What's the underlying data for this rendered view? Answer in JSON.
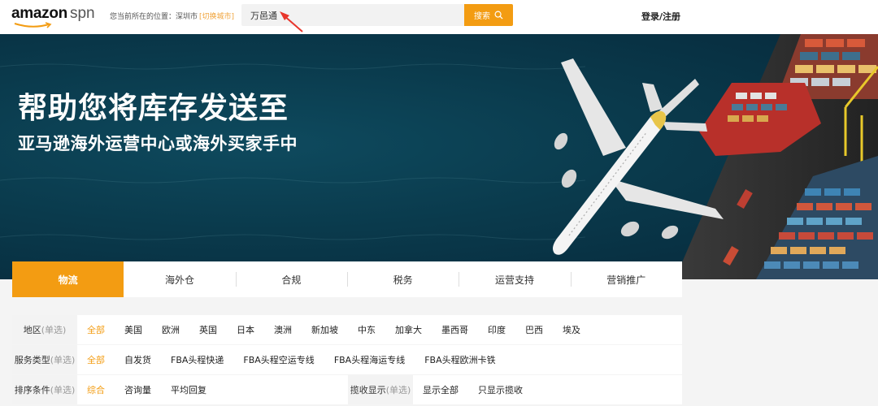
{
  "header": {
    "logo_main": "amazon",
    "logo_sub": "spn",
    "location_prefix": "您当前所在的位置：深圳市",
    "city_switch": "[切换城市]",
    "search_value": "万邑通",
    "search_button": "搜索",
    "login": "登录/注册"
  },
  "hero": {
    "title": "帮助您将库存发送至",
    "subtitle": "亚马逊海外运营中心或海外买家手中"
  },
  "tabs": [
    {
      "label": "物流",
      "active": true
    },
    {
      "label": "海外仓"
    },
    {
      "label": "合规"
    },
    {
      "label": "税务"
    },
    {
      "label": "运营支持"
    },
    {
      "label": "营销推广"
    }
  ],
  "filters": {
    "region": {
      "label": "地区",
      "mode": "(单选)",
      "options": [
        "全部",
        "美国",
        "欧洲",
        "英国",
        "日本",
        "澳洲",
        "新加坡",
        "中东",
        "加拿大",
        "墨西哥",
        "印度",
        "巴西",
        "埃及"
      ]
    },
    "service": {
      "label": "服务类型",
      "mode": "(单选)",
      "options": [
        "全部",
        "自发货",
        "FBA头程快递",
        "FBA头程空运专线",
        "FBA头程海运专线",
        "FBA头程欧洲卡铁"
      ]
    },
    "sort": {
      "label": "排序条件",
      "mode": "(单选)",
      "options": [
        "综合",
        "咨询量",
        "平均回复"
      ]
    },
    "collect": {
      "label": "揽收显示",
      "mode": "(单选)",
      "options": [
        "显示全部",
        "只显示揽收"
      ]
    }
  },
  "colors": {
    "accent": "#f39c12",
    "hero_bg": "#0a3a4c"
  }
}
